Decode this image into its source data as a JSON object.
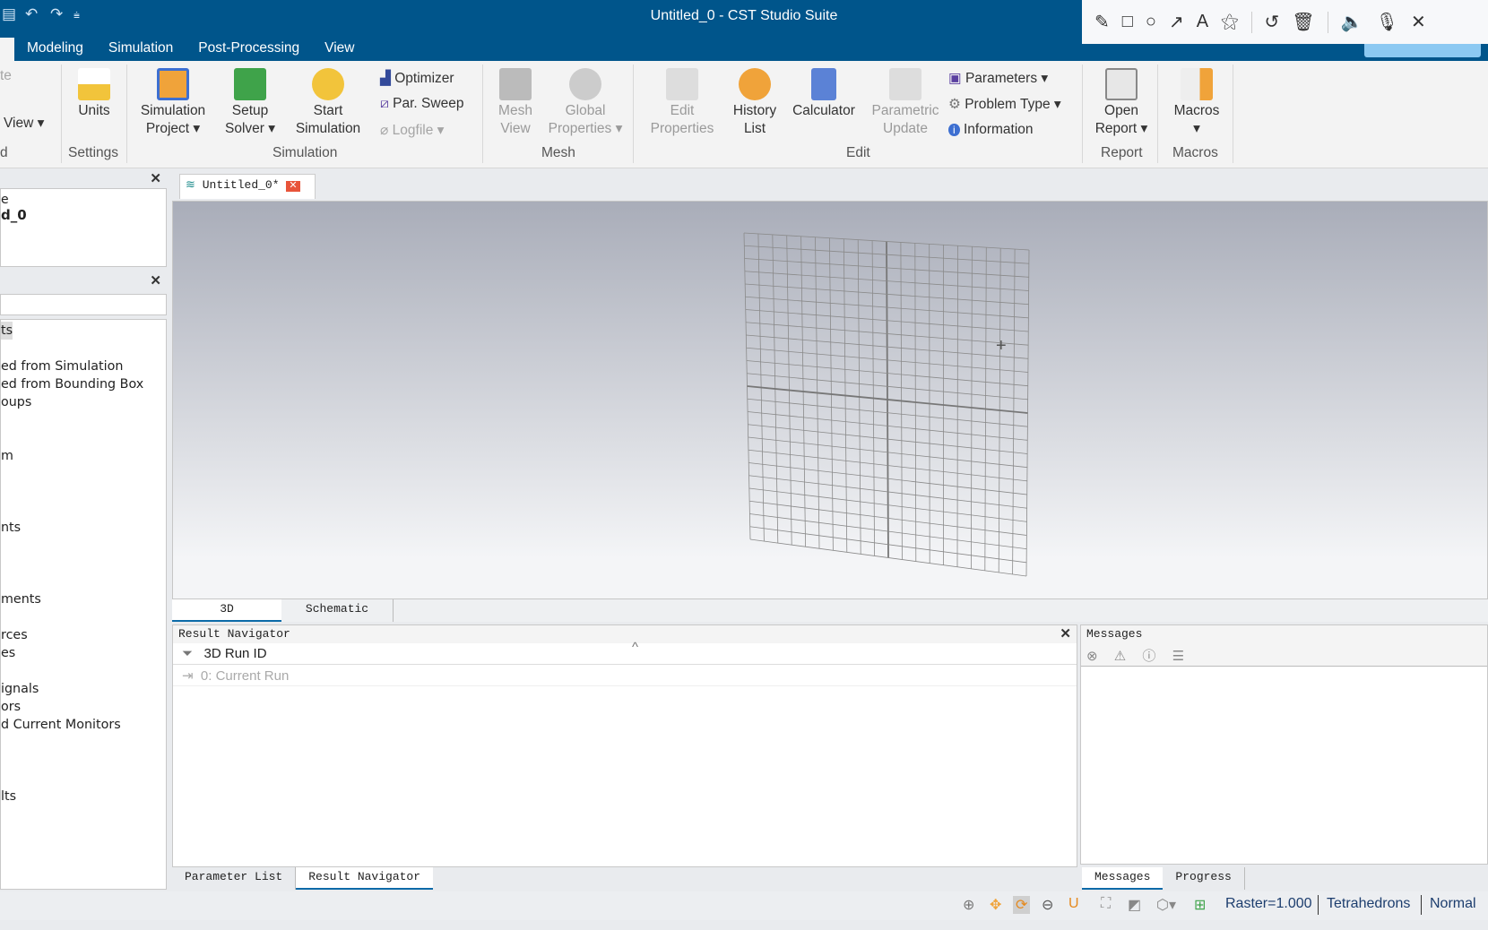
{
  "window": {
    "title": "Untitled_0 - CST Studio Suite"
  },
  "menu_tabs": [
    "Modeling",
    "Simulation",
    "Post-Processing",
    "View"
  ],
  "annotation_toolbar": [
    "pencil-icon",
    "rectangle-icon",
    "circle-icon",
    "arrow-icon",
    "text-icon",
    "magic-wand-icon",
    "undo-icon",
    "trash-icon",
    "speaker-icon",
    "microphone-icon",
    "close-icon"
  ],
  "ribbon": {
    "left_cut": {
      "item1": "te",
      "item2": "View",
      "group": "d"
    },
    "units": "Units",
    "settings_group": "Settings",
    "sim_project": [
      "Simulation",
      "Project"
    ],
    "setup_solver": [
      "Setup",
      "Solver"
    ],
    "start_sim": [
      "Start",
      "Simulation"
    ],
    "optimizer": "Optimizer",
    "par_sweep": "Par. Sweep",
    "logfile": "Logfile",
    "simulation_group": "Simulation",
    "mesh_view": [
      "Mesh",
      "View"
    ],
    "global_props": [
      "Global",
      "Properties"
    ],
    "mesh_group": "Mesh",
    "edit_props": [
      "Edit",
      "Properties"
    ],
    "history": [
      "History",
      "List"
    ],
    "calculator": "Calculator",
    "param_update": [
      "Parametric",
      "Update"
    ],
    "parameters": "Parameters",
    "problem_type": "Problem Type",
    "information": "Information",
    "edit_group": "Edit",
    "open_report": [
      "Open",
      "Report"
    ],
    "report_group": "Report",
    "macros": "Macros",
    "macros_group": "Macros"
  },
  "left_top": {
    "line1": "e",
    "line2": "d_0"
  },
  "tree": [
    "ts",
    "",
    "ed from Simulation",
    "ed from Bounding Box",
    "oups",
    "",
    "",
    "m",
    "",
    "",
    "",
    "nts",
    "",
    "",
    "",
    "ments",
    "",
    "rces",
    "es",
    "",
    "ignals",
    "ors",
    "d Current Monitors",
    "",
    "",
    "",
    "lts"
  ],
  "doc_tab": "Untitled_0*",
  "view_tabs": [
    "3D",
    "Schematic"
  ],
  "result_nav": {
    "title": "Result Navigator",
    "header": "3D Run ID",
    "row": "0: Current Run"
  },
  "messages": {
    "title": "Messages"
  },
  "bottom_tabs_left": [
    "Parameter List",
    "Result Navigator"
  ],
  "bottom_tabs_right": [
    "Messages",
    "Progress"
  ],
  "status": {
    "raster": "Raster=1.000",
    "mesh": "Tetrahedrons",
    "mode": "Normal"
  }
}
